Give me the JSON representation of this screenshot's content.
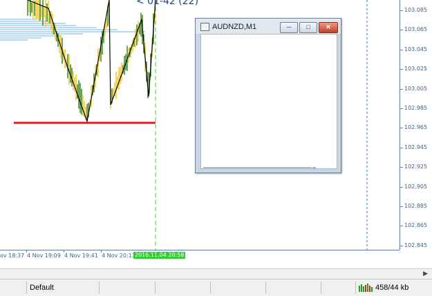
{
  "chart": {
    "overlay_text": "< 01-42 (22)",
    "price_labels": [
      "103.085",
      "103.065",
      "103.045",
      "103.025",
      "103.005",
      "102.985",
      "102.965",
      "102.945",
      "102.925",
      "102.905",
      "102.885",
      "102.865",
      "102.845"
    ],
    "time_labels": [
      "ov 18:37",
      "4 Nov 19:09",
      "4 Nov 19:41",
      "4 Nov 20:13"
    ],
    "time_marker": "2016.11.04 20:58",
    "colors": {
      "support_line": "#e31b1b",
      "bull": "#2e7d11",
      "bear": "#f0c419",
      "zigzag": "#000000",
      "marker": "#2fcf2f",
      "volume_profile": "#6fb7e8"
    }
  },
  "mini_window": {
    "title": "AUDNZD,M1",
    "minimize_icon": "minimize-icon",
    "restore_icon": "restore-icon",
    "close_icon": "close-icon"
  },
  "statusbar": {
    "profile": "Default",
    "traffic": "458/44 kb"
  }
}
